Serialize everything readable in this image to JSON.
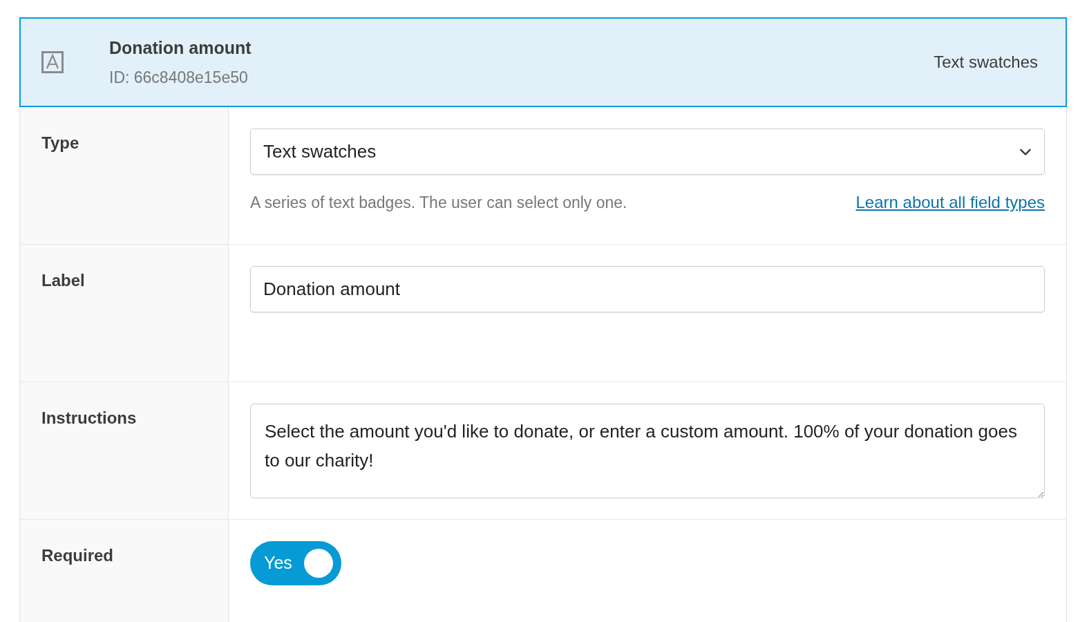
{
  "header": {
    "title": "Donation amount",
    "id_text": "ID: 66c8408e15e50",
    "type_text": "Text swatches",
    "selected": true
  },
  "fields": [
    {
      "kind": "select",
      "label": "Type",
      "value": "Text swatches",
      "help": "A series of text badges. The user can select only one.",
      "help_link": "Learn about all field types"
    },
    {
      "kind": "text",
      "label": "Label",
      "value": "Donation amount"
    },
    {
      "kind": "textarea",
      "label": "Instructions",
      "value": "Select the amount you'd like to donate, or enter a custom amount. 100% of your donation goes to our charity!"
    },
    {
      "kind": "toggle",
      "label": "Required",
      "on": true,
      "toggle_text": "Yes"
    }
  ]
}
